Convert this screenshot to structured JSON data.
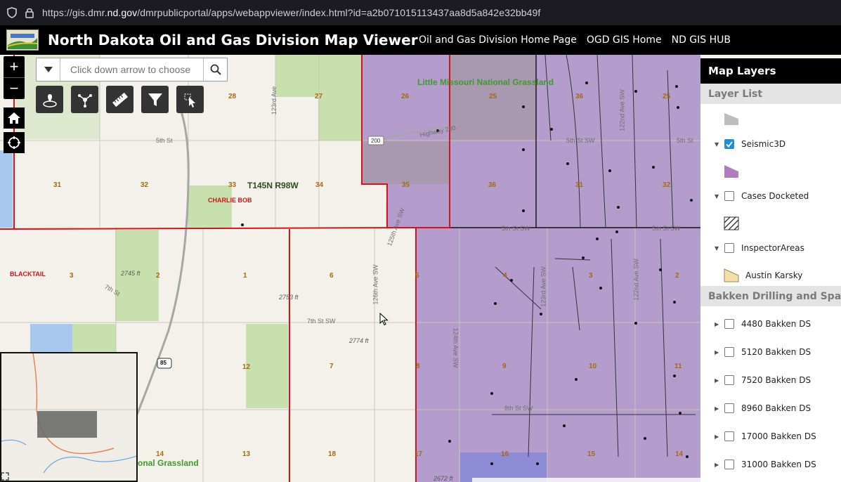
{
  "browser": {
    "url_prefix": "https://gis.dmr.",
    "url_host": "nd.gov",
    "url_suffix": "/dmrpublicportal/apps/webappviewer/index.html?id=a2b071015113437aa8d5a842e32bb49f"
  },
  "header": {
    "title": "North Dakota Oil and Gas Division Map Viewer",
    "links": [
      "Oil and Gas Division Home Page",
      "OGD GIS Home",
      "ND GIS HUB"
    ]
  },
  "search": {
    "placeholder": "Click down arrow to choose"
  },
  "map": {
    "grassland_top": "Little Missouri National Grassland",
    "grassland_bottom": "onal Grassland",
    "township": "T145N R98W",
    "places": [
      "CHARLIE BOB",
      "BLACKTAIL"
    ],
    "streets": [
      "5th St",
      "Highway 200",
      "5th St SW",
      "5th St",
      "7th St",
      "7th St SW",
      "8th St SW",
      "123rd Ave",
      "125th Ave SW",
      "126th Ave SW",
      "124th Ave SW",
      "123rd Ave SW",
      "122nd Ave SW",
      "122nd Ave SW",
      "5th St SW",
      "5th St SW"
    ],
    "elevations": [
      "2745 ft",
      "2753 ft",
      "2774 ft",
      "2672 ft"
    ],
    "sections": [
      "28",
      "27",
      "26",
      "25",
      "31",
      "32",
      "33",
      "34",
      "35",
      "36",
      "31",
      "32",
      "3",
      "2",
      "1",
      "6",
      "5",
      "4",
      "3",
      "2",
      "12",
      "7",
      "8",
      "9",
      "10",
      "11",
      "14",
      "13",
      "18",
      "17",
      "16",
      "15",
      "14",
      "36",
      "25"
    ],
    "route_shields": [
      "200",
      "85"
    ]
  },
  "panel": {
    "title": "Map Layers",
    "layer_list_label": "Layer List",
    "layers": [
      {
        "label": "Seismic3D",
        "checked": true
      },
      {
        "label": "Cases Docketed",
        "checked": false
      },
      {
        "label": "InspectorAreas",
        "checked": false
      }
    ],
    "legend_item": "Austin Karsky",
    "group_label": "Bakken Drilling and Spacing",
    "bakken": [
      "4480 Bakken DS",
      "5120 Bakken DS",
      "7520 Bakken DS",
      "8960 Bakken DS",
      "17000 Bakken DS",
      "31000 Bakken DS"
    ]
  },
  "colors": {
    "seismic": "#b49ccc",
    "boundary": "#d4141a",
    "grass": "#c8dfae",
    "water": "#a8c8f0"
  }
}
